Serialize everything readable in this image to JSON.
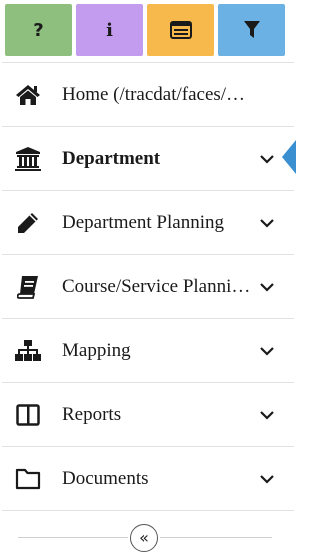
{
  "toolbar": {
    "help": {
      "label": "?",
      "icon": "question-icon",
      "color": "#8fbf7f"
    },
    "info": {
      "label": "i",
      "icon": "info-icon",
      "color": "#c39cf0"
    },
    "list": {
      "icon": "list-window-icon",
      "color": "#f8b94c"
    },
    "filter": {
      "icon": "filter-icon",
      "color": "#6cb1e4"
    }
  },
  "nav": {
    "home": {
      "label": "Home  (/tracdat/faces/…",
      "icon": "home-icon"
    },
    "department": {
      "label": "Department",
      "icon": "institution-icon",
      "active": true
    },
    "dept_planning": {
      "label": "Department Planning",
      "icon": "pencil-icon"
    },
    "course_planning": {
      "label": "Course/Service Planni…",
      "icon": "book-icon"
    },
    "mapping": {
      "label": "Mapping",
      "icon": "sitemap-icon"
    },
    "reports": {
      "label": "Reports",
      "icon": "columns-icon"
    },
    "documents": {
      "label": "Documents",
      "icon": "folder-icon"
    }
  },
  "collapse": {
    "label": "«",
    "icon": "double-chevron-left-icon"
  },
  "colors": {
    "accent": "#3a8fd0",
    "separator": "#e2e2e2",
    "text": "#1a1a1a"
  }
}
